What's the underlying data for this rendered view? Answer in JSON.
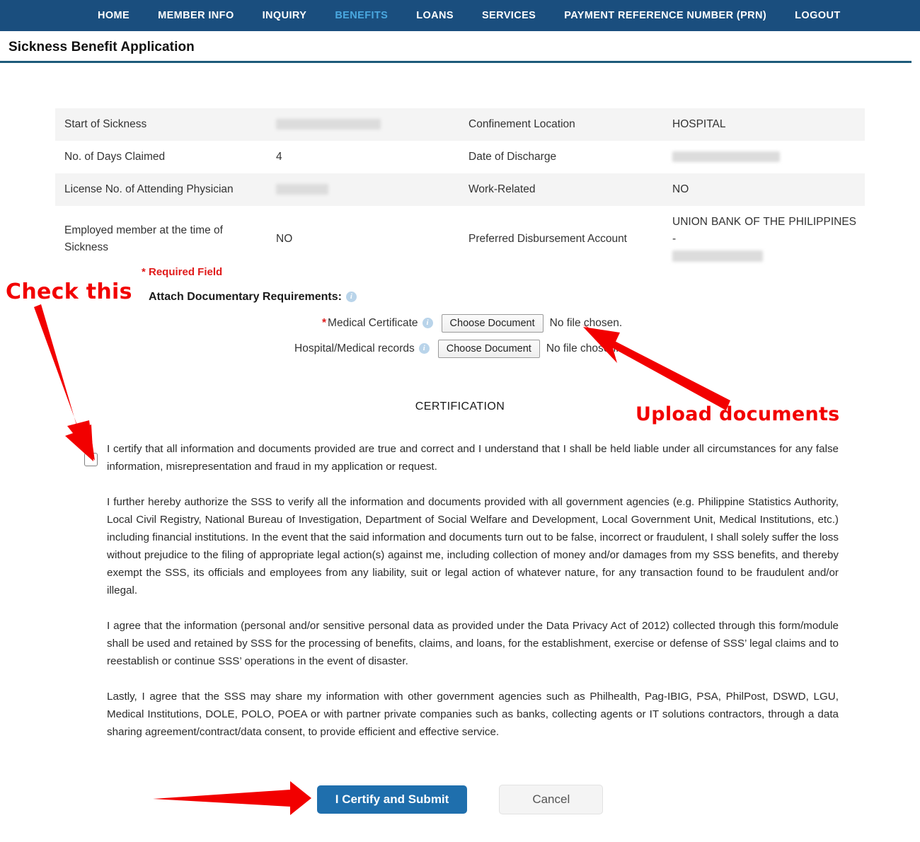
{
  "nav": {
    "items": [
      {
        "label": "HOME",
        "active": false
      },
      {
        "label": "MEMBER INFO",
        "active": false
      },
      {
        "label": "INQUIRY",
        "active": false
      },
      {
        "label": "BENEFITS",
        "active": true
      },
      {
        "label": "LOANS",
        "active": false
      },
      {
        "label": "SERVICES",
        "active": false
      },
      {
        "label": "PAYMENT REFERENCE NUMBER (PRN)",
        "active": false
      },
      {
        "label": "LOGOUT",
        "active": false
      }
    ],
    "active_color": "#4aa8e0",
    "bar_color": "#1a4e7e"
  },
  "page": {
    "title": "Sickness Benefit Application",
    "rule_color": "#1d5b7a"
  },
  "summary_table": {
    "rows": [
      {
        "left_label": "Start of Sickness",
        "left_value": "",
        "left_redacted": true,
        "right_label": "Confinement Location",
        "right_value": "HOSPITAL",
        "right_redacted": false
      },
      {
        "left_label": "No. of Days Claimed",
        "left_value": "4",
        "left_redacted": false,
        "right_label": "Date of Discharge",
        "right_value": "",
        "right_redacted": true
      },
      {
        "left_label": "License No. of Attending Physician",
        "left_value": "",
        "left_redacted": true,
        "right_label": "Work-Related",
        "right_value": "NO",
        "right_redacted": false
      },
      {
        "left_label": "Employed member at the time of Sickness",
        "left_value": "NO",
        "left_redacted": false,
        "right_label": "Preferred Disbursement Account",
        "right_value": "UNION BANK OF THE PHILIPPINES -",
        "right_redacted": true
      }
    ]
  },
  "form": {
    "required_note": "* Required Field",
    "attach_label": "Attach Documentary Requirements:",
    "info_icon_glyph": "i",
    "uploads": [
      {
        "label": "Medical Certificate",
        "required": true,
        "button_label": "Choose Document",
        "file_status": "No file chosen."
      },
      {
        "label": "Hospital/Medical records",
        "required": false,
        "button_label": "Choose Document",
        "file_status": "No file chosen."
      }
    ]
  },
  "certification": {
    "heading": "CERTIFICATION",
    "checkbox_checked": false,
    "paragraphs": [
      "I certify that all information and documents provided are true and correct and I understand that I shall be held liable under all circumstances for any false information, misrepresentation and fraud in my application or request.",
      "I further hereby authorize the SSS to verify all the information and documents provided with all government agencies (e.g. Philippine Statistics Authority, Local Civil Registry, National Bureau of Investigation, Department of Social Welfare and Development, Local Government Unit, Medical Institutions, etc.) including financial institutions. In the event that the said information and documents turn out to be false, incorrect or fraudulent, I shall solely suffer the loss without prejudice to the filing of appropriate legal action(s) against me, including collection of money and/or damages from my SSS benefits, and thereby exempt the SSS, its officials and employees from any liability, suit or legal action of whatever nature, for any transaction found to be fraudulent and/or illegal.",
      "I agree that the information (personal and/or sensitive personal data as provided under the Data Privacy Act of 2012) collected through this form/module shall be used and retained by SSS for the processing of benefits, claims, and loans, for the establishment, exercise or defense of SSS’ legal claims and to reestablish or continue SSS’ operations in the event of disaster.",
      "Lastly, I agree that the SSS may share my information with other government agencies such as Philhealth, Pag-IBIG, PSA, PhilPost, DSWD, LGU, Medical Institutions, DOLE, POLO, POEA or with partner private companies such as banks, collecting agents or IT solutions contractors, through a data sharing agreement/contract/data consent, to provide efficient and effective service."
    ]
  },
  "actions": {
    "submit_label": "I Certify and Submit",
    "cancel_label": "Cancel",
    "submit_color": "#1f6fad"
  },
  "annotations": {
    "color": "#f20000",
    "check_this": "Check this",
    "upload_documents": "Upload documents"
  }
}
